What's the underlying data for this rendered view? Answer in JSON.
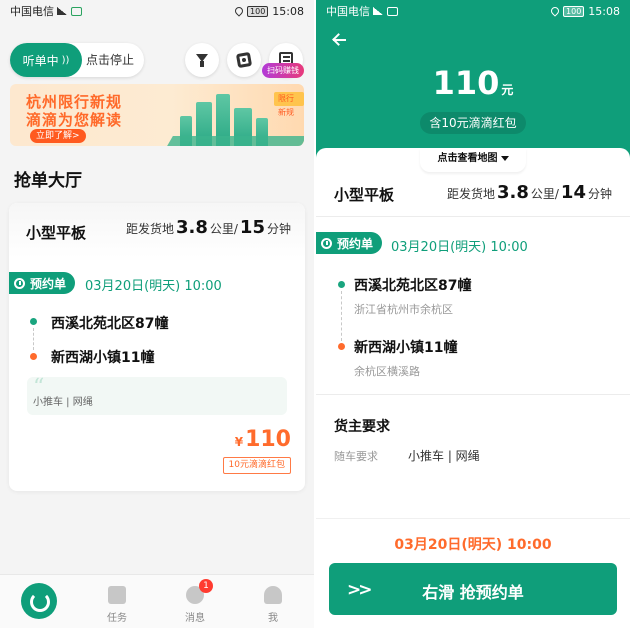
{
  "status_bar": {
    "carrier": "中国电信",
    "signal": "4G",
    "battery": "100",
    "time": "15:08"
  },
  "left": {
    "listen": {
      "on_label": "听单中",
      "stop_label": "点击停止"
    },
    "scan_badge": "扫码赚钱",
    "banner": {
      "line1": "杭州限行新规",
      "line2": "滴滴为您解读",
      "button": "立即了解>",
      "sign": "限行新规"
    },
    "hall_title": "抢单大厅",
    "order": {
      "vehicle": "小型平板",
      "dist_prefix": "距发货地",
      "dist_km": "3.8",
      "dist_km_unit": "公里/",
      "dist_min": "15",
      "dist_min_unit": "分钟",
      "appt_label": "预约单",
      "appt_time": "03月20日(明天) 10:00",
      "from": "西溪北苑北区87幢",
      "to": "新西湖小镇11幢",
      "notes": "小推车 | 网绳",
      "currency": "¥",
      "price": "110",
      "red_packet": "10元滴滴红包"
    },
    "tabs": [
      {
        "label": ""
      },
      {
        "label": "任务"
      },
      {
        "label": "消息",
        "badge": "1"
      },
      {
        "label": "我"
      }
    ]
  },
  "right": {
    "price": "110",
    "price_unit": "元",
    "red_packet": "含10元滴滴红包",
    "map_toggle": "点击查看地图",
    "vehicle": "小型平板",
    "dist_prefix": "距发货地",
    "dist_km": "3.8",
    "dist_km_unit": "公里/",
    "dist_min": "14",
    "dist_min_unit": "分钟",
    "appt_label": "预约单",
    "appt_time": "03月20日(明天) 10:00",
    "from": {
      "name": "西溪北苑北区87幢",
      "area": "浙江省杭州市余杭区"
    },
    "to": {
      "name": "新西湖小镇11幢",
      "area": "余杭区横溪路"
    },
    "req_title": "货主要求",
    "req_label": "随车要求",
    "req_value": "小推车 | 网绳",
    "bottom_time": "03月20日(明天) 10:00",
    "grab_button": "右滑 抢预约单"
  },
  "colors": {
    "primary": "#0f9e7a",
    "accent_orange": "#ff6b2c",
    "banner_text": "#ff6a2a"
  }
}
